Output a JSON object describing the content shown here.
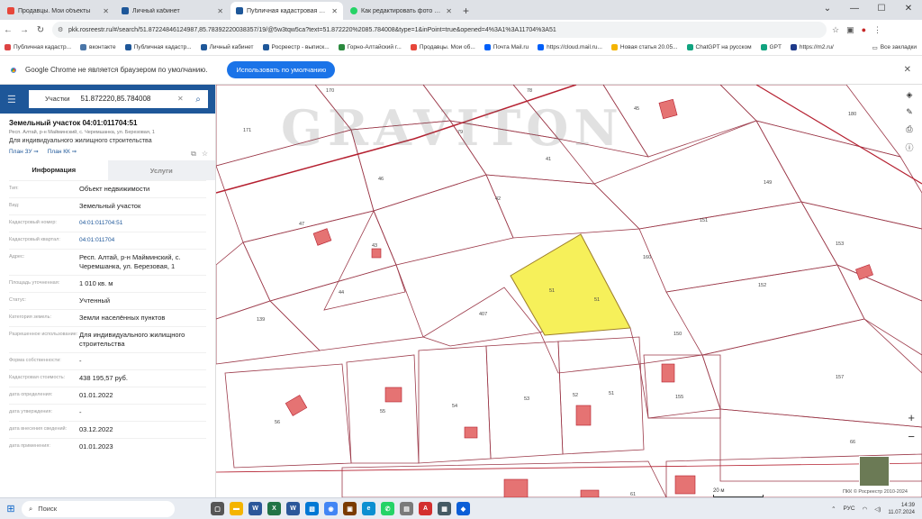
{
  "browser": {
    "tabs": [
      {
        "label": "Продавцы. Мои объекты",
        "color": "#e7463a"
      },
      {
        "label": "Личный кабинет",
        "color": "#1e5799"
      },
      {
        "label": "Публичная кадастровая карта",
        "color": "#1e5799"
      },
      {
        "label": "Как редактировать фото и вы...",
        "color": "#25d366"
      }
    ],
    "url": "pkk.rosreestr.ru/#/search/51.87224846124987,85.78392220038357/19/@5w3tqw5ca?text=51.872220%2085.784008&type=1&inPoint=true&opened=4%3A1%3A11704%3A51",
    "bookmarks": [
      {
        "label": "Публичная кадастр...",
        "color": "#d44"
      },
      {
        "label": "вконтакте",
        "color": "#4a76a8"
      },
      {
        "label": "Публичная кадастр...",
        "color": "#1e5799"
      },
      {
        "label": "Личный кабинет",
        "color": "#1e5799"
      },
      {
        "label": "Росреестр - выписк...",
        "color": "#1e5799"
      },
      {
        "label": "Горно-Алтайский г...",
        "color": "#2b8a3e"
      },
      {
        "label": "Продавцы. Мои об...",
        "color": "#e7463a"
      },
      {
        "label": "Почта Mail.ru",
        "color": "#005ff9"
      },
      {
        "label": "https://cloud.mail.ru...",
        "color": "#005ff9"
      },
      {
        "label": "Новая статья 20.05...",
        "color": "#f4b400"
      },
      {
        "label": "ChatGPT на русском",
        "color": "#10a37f"
      },
      {
        "label": "GPT",
        "color": "#10a37f"
      },
      {
        "label": "https://m2.ru/",
        "color": "#1e3a8a"
      }
    ],
    "all_bookmarks": "Все закладки"
  },
  "infobar": {
    "message": "Google Chrome не является браузером по умолчанию.",
    "button": "Использовать по умолчанию"
  },
  "search": {
    "type": "Участки",
    "query": "51.872220,85.784008"
  },
  "parcel": {
    "title": "Земельный участок 04:01:011704:51",
    "address": "Респ. Алтай, р-н Майминский, с. Черемшанка, ул. Березовая, 1",
    "purpose": "Для индивидуального жилищного строительства",
    "link_zu": "План ЗУ",
    "link_kk": "План КК",
    "tab_info": "Информация",
    "tab_services": "Услуги",
    "rows": [
      {
        "key": "Тип:",
        "value": "Объект недвижимости"
      },
      {
        "key": "Вид:",
        "value": "Земельный участок"
      },
      {
        "key": "Кадастровый номер:",
        "value": "04:01:011704:51"
      },
      {
        "key": "Кадастровый квартал:",
        "value": "04:01:011704"
      },
      {
        "key": "Адрес:",
        "value": "Респ. Алтай, р-н Майминский, с. Черемшанка, ул. Березовая, 1"
      },
      {
        "key": "Площадь уточненная:",
        "value": "1 010 кв. м"
      },
      {
        "key": "Статус:",
        "value": "Учтенный"
      },
      {
        "key": "Категория земель:",
        "value": "Земли населённых пунктов"
      },
      {
        "key": "Разрешенное использование:",
        "value": "Для индивидуального жилищного строительства"
      },
      {
        "key": "Форма собственности:",
        "value": "-"
      },
      {
        "key": "Кадастровая стоимость:",
        "value": "438 195,57 руб."
      },
      {
        "key": "дата определения:",
        "value": "01.01.2022"
      },
      {
        "key": "дата утверждения:",
        "value": "-"
      },
      {
        "key": "дата внесения сведений:",
        "value": "03.12.2022"
      },
      {
        "key": "дата применения:",
        "value": "01.01.2023"
      }
    ]
  },
  "map": {
    "watermark": "GRAVITON",
    "scale": "20 м",
    "copyright": "ПКК © Росреестр 2010-2024",
    "labels": [
      "170",
      "78",
      "171",
      "79",
      "45",
      "180",
      "41",
      "46",
      "42",
      "149",
      "47",
      "43",
      "151",
      "160",
      "153",
      "44",
      "51",
      "51",
      "407",
      "152",
      "139",
      "150",
      "56",
      "55",
      "54",
      "53",
      "52",
      "51",
      "155",
      "157",
      "66",
      "61"
    ]
  },
  "taskbar": {
    "search": "Поиск",
    "lang": "РУС",
    "time": "14:39",
    "date": "11.07.2024"
  }
}
